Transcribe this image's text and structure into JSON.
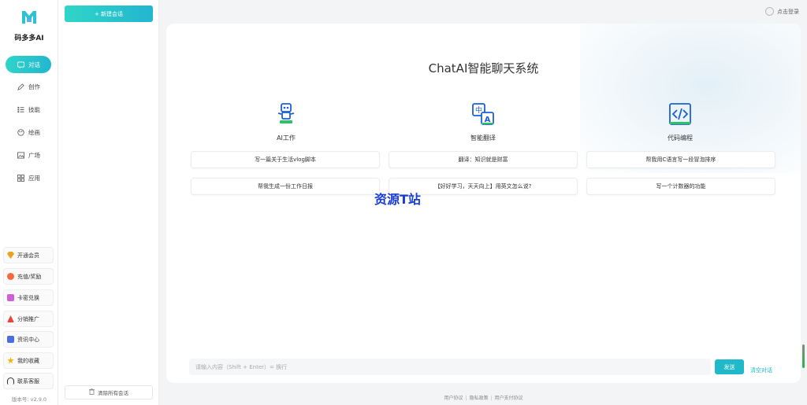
{
  "brand": {
    "name": "码多多AI"
  },
  "nav": [
    {
      "label": "对话",
      "icon": "chat-icon",
      "active": true
    },
    {
      "label": "创作",
      "icon": "pen-icon"
    },
    {
      "label": "技能",
      "icon": "list-icon"
    },
    {
      "label": "绘画",
      "icon": "palette-icon"
    },
    {
      "label": "广场",
      "icon": "image-icon"
    },
    {
      "label": "应用",
      "icon": "apps-icon"
    }
  ],
  "utilities": [
    {
      "label": "开通会员",
      "icon": "vip-icon",
      "color": "#f0a020"
    },
    {
      "label": "充值/奖励",
      "icon": "coin-icon",
      "color": "#f36b3b"
    },
    {
      "label": "卡密兑换",
      "icon": "card-icon",
      "color": "#d05fd8"
    },
    {
      "label": "分销推广",
      "icon": "share-icon",
      "color": "#e9453a"
    },
    {
      "label": "资讯中心",
      "icon": "news-icon",
      "color": "#4a6ee0"
    },
    {
      "label": "我的收藏",
      "icon": "star-icon",
      "color": "#f5b400"
    },
    {
      "label": "联系客服",
      "icon": "headset-icon",
      "color": "#333333"
    }
  ],
  "version": "版本号: v2.9.0",
  "sessions": {
    "new_label": "+ 新建会话",
    "clear_all_label": "清除所有会话"
  },
  "header": {
    "login_label": "点击登录"
  },
  "main": {
    "title": "ChatAI智能聊天系统",
    "features": [
      {
        "label": "AI工作",
        "icon": "robot-icon"
      },
      {
        "label": "智能翻译",
        "icon": "translate-icon"
      },
      {
        "label": "代码编程",
        "icon": "code-icon"
      }
    ],
    "prompts": [
      "写一篇关于生活vlog脚本",
      "翻译：知识就是财富",
      "帮我用C语言写一段冒泡排序",
      "帮我生成一份工作日报",
      "【好好学习，天天向上】用英文怎么说?",
      "写一个计数器的功能"
    ],
    "watermark": "资源T站"
  },
  "input": {
    "placeholder": "请输入内容（Shift + Enter）= 换行",
    "send_label": "发送",
    "clear_label": "清空对话"
  },
  "footer": {
    "links": [
      "用户协议",
      "隐私政策",
      "用户支付协议"
    ]
  },
  "colors": {
    "accent": "#22b6cf",
    "accent_light": "#2fd5c8"
  }
}
